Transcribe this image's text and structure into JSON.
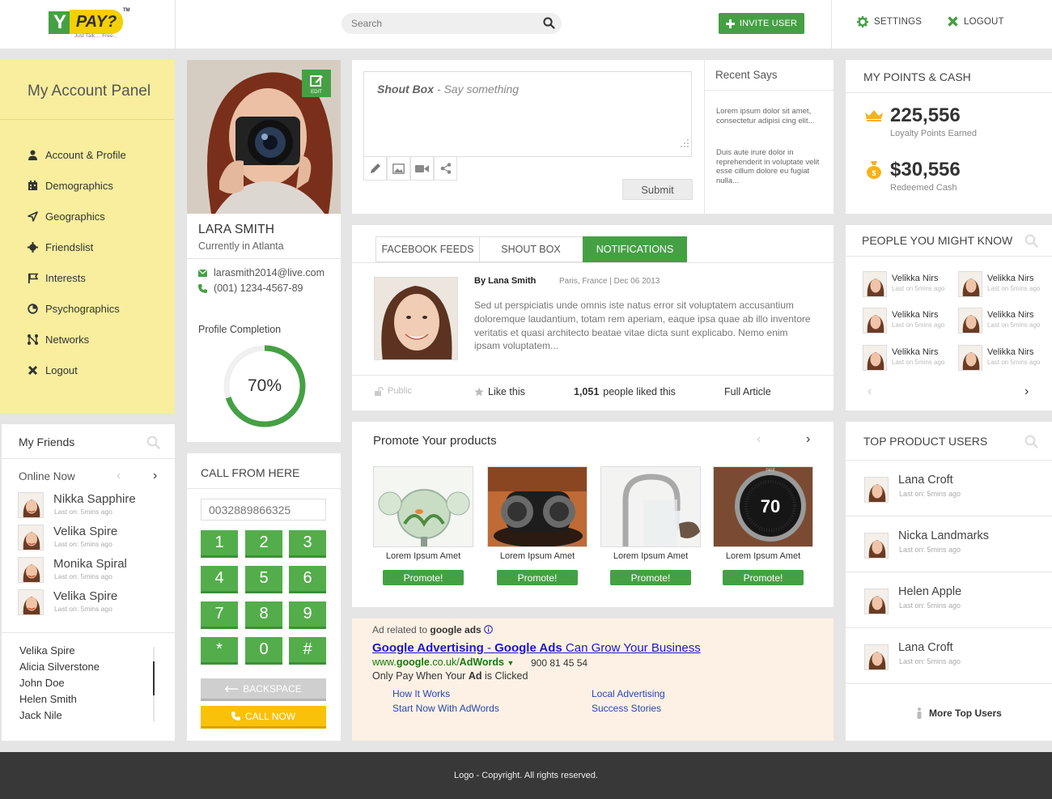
{
  "header": {
    "logo_text": "PAY?",
    "logo_letter": "Y",
    "logo_tm": "TM",
    "logo_tagline": "Just Talk.... Free...",
    "search_placeholder": "Search",
    "invite_label": "INVITE USER",
    "settings_label": "SETTINGS",
    "logout_label": "LOGOUT"
  },
  "sidebar": {
    "title": "My Account Panel",
    "items": [
      {
        "label": "Account & Profile",
        "icon": "user-icon"
      },
      {
        "label": "Demographics",
        "icon": "demographics-icon"
      },
      {
        "label": "Geographics",
        "icon": "location-arrow-icon"
      },
      {
        "label": "Friendslist",
        "icon": "friends-icon"
      },
      {
        "label": "Interests",
        "icon": "flag-icon"
      },
      {
        "label": "Psychographics",
        "icon": "pie-chart-icon"
      },
      {
        "label": "Networks",
        "icon": "network-icon"
      },
      {
        "label": "Logout",
        "icon": "close-icon"
      }
    ]
  },
  "friends": {
    "title": "My Friends",
    "online_label": "Online Now",
    "online": [
      {
        "name": "Nikka Sapphire",
        "sub": "Last on: 5mins ago"
      },
      {
        "name": "Velika Spire",
        "sub": "Last on: 5mins ago"
      },
      {
        "name": "Monika Spiral",
        "sub": "Last on: 5mins ago"
      },
      {
        "name": "Velika Spire",
        "sub": "Last on: 5mins ago"
      }
    ],
    "list": [
      "Velika Spire",
      "Alicia Silverstone",
      "John Doe",
      "Helen Smith",
      "Jack Nile"
    ]
  },
  "profile": {
    "edit_label": "EDIT",
    "name": "LARA SMITH",
    "location": "Currently in Atlanta",
    "email": "larasmith2014@live.com",
    "phone": "(001) 1234-4567-89",
    "completion_label": "Profile Completion",
    "completion_value": 70,
    "completion_text": "70%"
  },
  "call": {
    "title": "CALL FROM HERE",
    "number": "0032889866325",
    "keys": [
      "1",
      "2",
      "3",
      "4",
      "5",
      "6",
      "7",
      "8",
      "9",
      "*",
      "0",
      "#"
    ],
    "backspace_label": "BACKSPACE",
    "call_label": "CALL NOW"
  },
  "shout": {
    "placeholder_bold": "Shout Box",
    "placeholder_rest": " - Say something",
    "submit_label": "Submit"
  },
  "recent": {
    "title": "Recent Says",
    "items": [
      "Lorem ipsum dolor sit amet, consectetur adipisi cing elit...",
      "Duis aute irure dolor in reprehenderit in voluptate velit esse cillum dolore eu fugiat nulla..."
    ]
  },
  "feed": {
    "tabs": [
      "FACEBOOK FEEDS",
      "SHOUT BOX",
      "NOTIFICATIONS"
    ],
    "active_tab": 2,
    "author": "By Lana Smith",
    "meta": "Paris, France  |  Dec 06 2013",
    "body": "Sed ut perspiciatis unde omnis iste natus error sit voluptatem accusantium doloremque laudantium, totam rem aperiam, eaque ipsa quae ab illo inventore veritatis et quasi architecto beatae vitae dicta sunt explicabo. Nemo enim ipsam voluptatem...",
    "privacy": "Public",
    "like_label": "Like this",
    "likes_count": "1,051",
    "likes_text": "people liked this",
    "full_article": "Full Article"
  },
  "promote": {
    "title": "Promote Your products",
    "products": [
      {
        "name": "Lorem Ipsum Amet",
        "button": "Promote!"
      },
      {
        "name": "Lorem Ipsum Amet",
        "button": "Promote!"
      },
      {
        "name": "Lorem Ipsum Amet",
        "button": "Promote!"
      },
      {
        "name": "Lorem Ipsum Amet",
        "button": "Promote!"
      }
    ],
    "thermostat_value": "70",
    "thermostat_brand": "nest"
  },
  "ad": {
    "label_prefix": "Ad related to ",
    "label_bold": "google ads",
    "title_a": "Google Advertising",
    "title_sep": " - ",
    "title_b": "Google Ads",
    "title_rest": " Can Grow Your Business",
    "url_prefix": "www.",
    "url_bold": "google",
    "url_mid": ".co.uk/",
    "url_end": "AdWords",
    "phone": "900 81 45 54",
    "desc_a": "Only Pay When Your ",
    "desc_bold": "Ad",
    "desc_b": " is Clicked",
    "links": [
      "How It Works",
      "Local Advertising",
      "Start Now With AdWords",
      "Success Stories"
    ]
  },
  "points": {
    "title": "MY POINTS & CASH",
    "points_value": "225,556",
    "points_label": "Loyalty Points Earned",
    "cash_value": "$30,556",
    "cash_label": "Redeemed Cash"
  },
  "people": {
    "title": "PEOPLE YOU MIGHT KNOW",
    "items": [
      {
        "name": "Velikka Nirs",
        "sub": "Last on 5mins ago"
      },
      {
        "name": "Velikka Nirs",
        "sub": "Last on 5mins ago"
      },
      {
        "name": "Velikka Nirs",
        "sub": "Last on 5mins ago"
      },
      {
        "name": "Velikka Nirs",
        "sub": "Last on 5mins ago"
      },
      {
        "name": "Velikka Nirs",
        "sub": "Last on 5mins ago"
      },
      {
        "name": "Velikka Nirs",
        "sub": "Last on 5mins ago"
      }
    ]
  },
  "top_users": {
    "title": "TOP PRODUCT USERS",
    "items": [
      {
        "name": "Lana Croft",
        "sub": "Last on: 5mins ago"
      },
      {
        "name": "Nicka Landmarks",
        "sub": "Last on: 5mins ago"
      },
      {
        "name": "Helen Apple",
        "sub": "Last on: 5mins ago"
      },
      {
        "name": "Lana Croft",
        "sub": "Last on: 5mins ago"
      }
    ],
    "more_label": "More Top Users"
  },
  "footer": {
    "text": "Logo - Copyright. All rights reserved."
  },
  "colors": {
    "accent": "#45a044",
    "sidebar": "#f8ee9e",
    "call": "#f9c10a",
    "footer": "#383838"
  }
}
